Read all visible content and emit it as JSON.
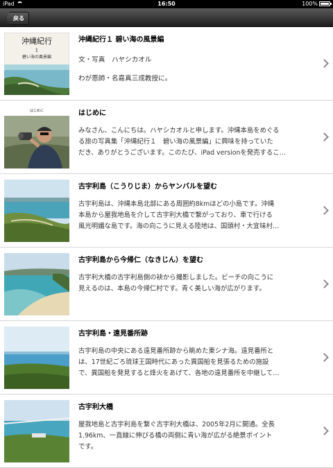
{
  "statusbar": {
    "device": "iPad",
    "time": "16:50",
    "battery": "100%"
  },
  "navbar": {
    "back_label": "戻る"
  },
  "rows": [
    {
      "thumb": "cover",
      "cover_title": "沖縄紀行",
      "cover_num": "1",
      "cover_sub": "碧い海の風景編",
      "title": "沖縄紀行１ 碧い海の風景編",
      "lines": [
        "文・写真　ハヤシカオル",
        "わが恩師・名嘉真三成教授に。"
      ]
    },
    {
      "thumb": "person",
      "thumb_caption": "はじめに",
      "title": "はじめに",
      "lines": [
        "みなさん、こんにちは。ハヤシカオルと申します。沖縄本島をめぐる",
        "る旅の写真集「沖縄紀行１　碧い海の風景編」に興味を持っていた",
        "だき、ありがとうございます。このたび、iPad versionを発売するこ…"
      ]
    },
    {
      "thumb": "cliff",
      "title": "古宇利島（こうりじま）からヤンバルを望む",
      "lines": [
        "古宇利島は、沖縄本島北部にある周囲約8kmほどの小島です。沖縄",
        "本島から屋我地島を介して古宇利大橋で繋がっており、車で行ける",
        "風光明媚な島です。海の向こうに見える陸地は、国頭村・大宜味村…"
      ]
    },
    {
      "thumb": "beach",
      "title": "古宇利島から今帰仁（なきじん）を望む",
      "lines": [
        "古宇利大橋の古宇利島側の袂から撮影しました。ビーチの向こうに",
        "見えるのは、本島の今帰仁村です。青く美しい海が広がります。"
      ]
    },
    {
      "thumb": "sea",
      "title": "古宇利島・遠見番所跡",
      "lines": [
        "古宇利島の中央にある遠見番所跡から眺めた東シナ海。遠見番所と",
        "は、17世紀ごろ琉球王国時代にあった異国船を見張るための施設",
        "で、異国船を発見すると烽火をあげて、各地の遠見番所を中継して…"
      ]
    },
    {
      "thumb": "bridge",
      "title": "古宇利大橋",
      "lines": [
        "屋我地島と古宇利島を繋ぐ古宇利大橋は、2005年2月に開通。全長",
        "1.96km、一直線に伸びる橋の両側に青い海が広がる絶景ポイント",
        "です。"
      ]
    }
  ]
}
